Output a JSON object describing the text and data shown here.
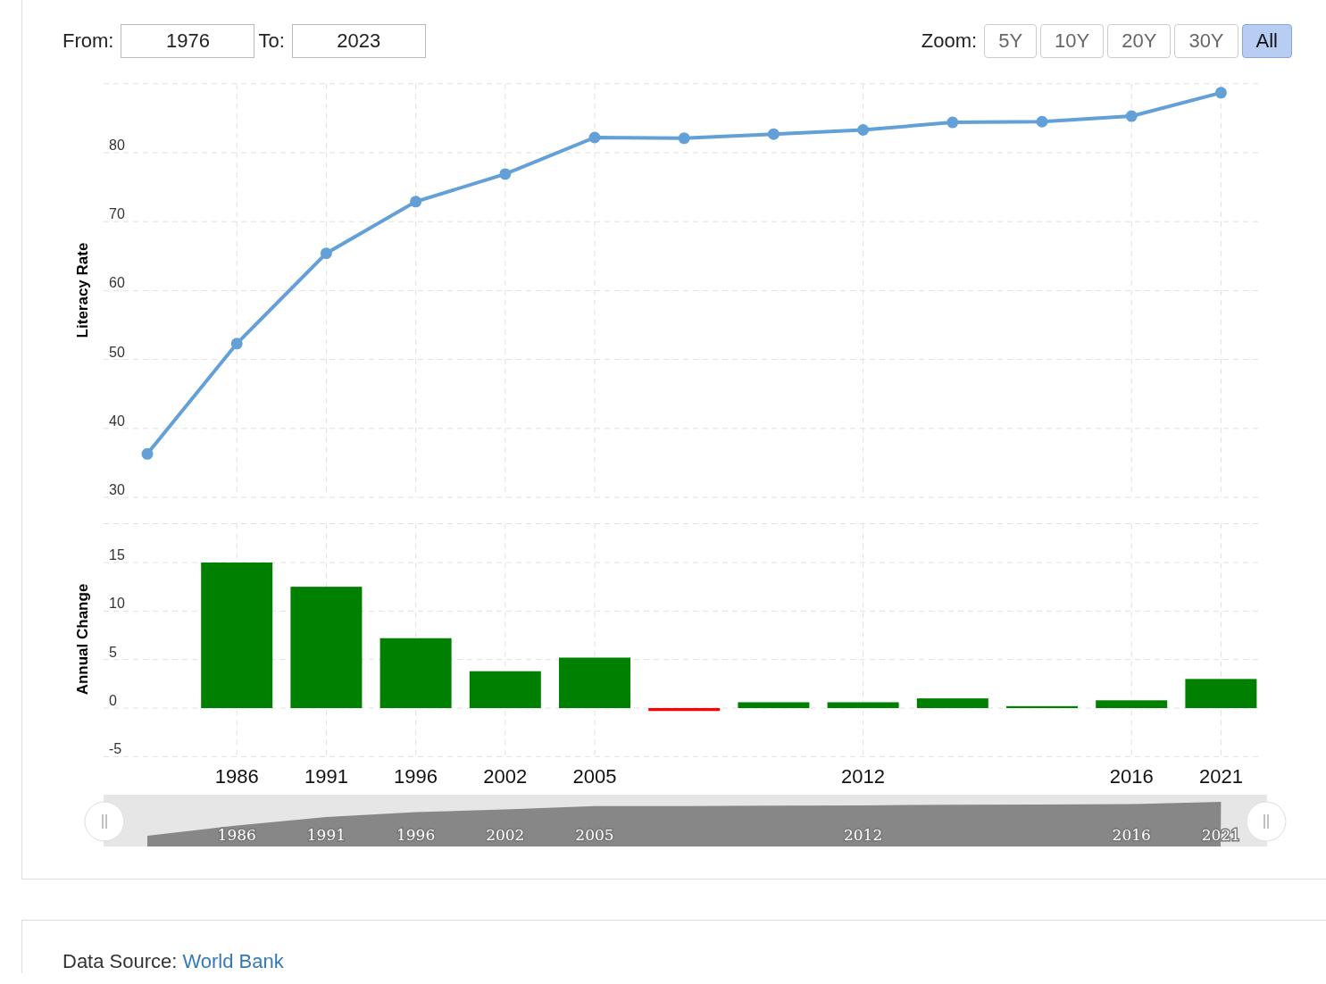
{
  "range": {
    "from_label": "From:",
    "from_value": "1976",
    "to_label": "To:",
    "to_value": "2023"
  },
  "zoom": {
    "label": "Zoom:",
    "buttons": [
      {
        "label": "5Y",
        "selected": false
      },
      {
        "label": "10Y",
        "selected": false
      },
      {
        "label": "20Y",
        "selected": false
      },
      {
        "label": "30Y",
        "selected": false
      },
      {
        "label": "All",
        "selected": true
      }
    ]
  },
  "literacy_chart": {
    "chart_data": {
      "type": "line",
      "ylabel": "Literacy Rate",
      "ylim": [
        30,
        90
      ],
      "yticks": [
        30,
        40,
        50,
        60,
        70,
        80
      ],
      "grid": true,
      "series": [
        {
          "color": "#64a0d8",
          "marker": true,
          "values": [
            36.3,
            52.3,
            65.4,
            72.9,
            76.9,
            82.2,
            82.1,
            82.7,
            83.3,
            84.4,
            84.5,
            85.3,
            88.7
          ]
        }
      ]
    }
  },
  "change_chart": {
    "chart_data": {
      "type": "bar",
      "ylabel": "Annual Change",
      "categories": [
        null,
        "1986",
        "1991",
        "1996",
        "2002",
        "2005",
        null,
        null,
        "2012",
        null,
        null,
        "2016",
        "2021"
      ],
      "ylim": [
        -5,
        19
      ],
      "yticks": [
        -5,
        0,
        5,
        10,
        15
      ],
      "grid": true,
      "stacked": true,
      "series": [
        {
          "color": "#008000",
          "values": [
            null,
            15.0,
            12.5,
            7.2,
            3.8,
            5.2,
            null,
            0.6,
            0.6,
            1.0,
            0.2,
            0.8,
            3.0
          ]
        },
        {
          "color": "#ff0000",
          "values": [
            null,
            null,
            null,
            null,
            null,
            null,
            -0.3,
            null,
            null,
            null,
            null,
            null,
            null
          ]
        }
      ]
    }
  },
  "navigator": {
    "labels": [
      "1986",
      "1991",
      "1996",
      "2002",
      "2005",
      "2012",
      "2016",
      "2021"
    ]
  },
  "source": {
    "label": "Data Source:",
    "link": "World Bank"
  }
}
